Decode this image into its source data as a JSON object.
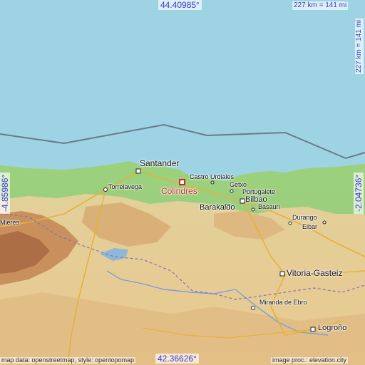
{
  "map": {
    "coords": {
      "top_lat": "44.40985°",
      "bottom_lat": "42.36626°",
      "left_lon": "-4.85986°",
      "right_lon": "-2.04736°"
    },
    "scale": "227 km = 141 mi",
    "focus_place": "Colindres",
    "places": {
      "santander": "Santander",
      "torrelavega": "Torrelavega",
      "castro_urdiales": "Castro Urdiales",
      "getxo": "Getxo",
      "portugalete": "Portugalete",
      "barakaldo": "Barakaldo",
      "bilbao": "Bilbao",
      "basauri": "Basauri",
      "durango": "Durango",
      "eibar": "Eibar",
      "vitoria": "Vitoria-Gasteiz",
      "miranda": "Miranda de Ebro",
      "logrono": "Logroño",
      "mieres": "Mieres"
    },
    "credits": {
      "left": "map data: openstreetmap, style: opentopomap",
      "right": "image proc.: elevation.city"
    },
    "colors": {
      "sea": "#9dd3e3",
      "coast_green": "#7cc76a",
      "terrain": "#e5cf9c",
      "mountain": "#c58a57",
      "focus_marker": "#d42424",
      "coord_text": "#3a3ad0"
    }
  }
}
